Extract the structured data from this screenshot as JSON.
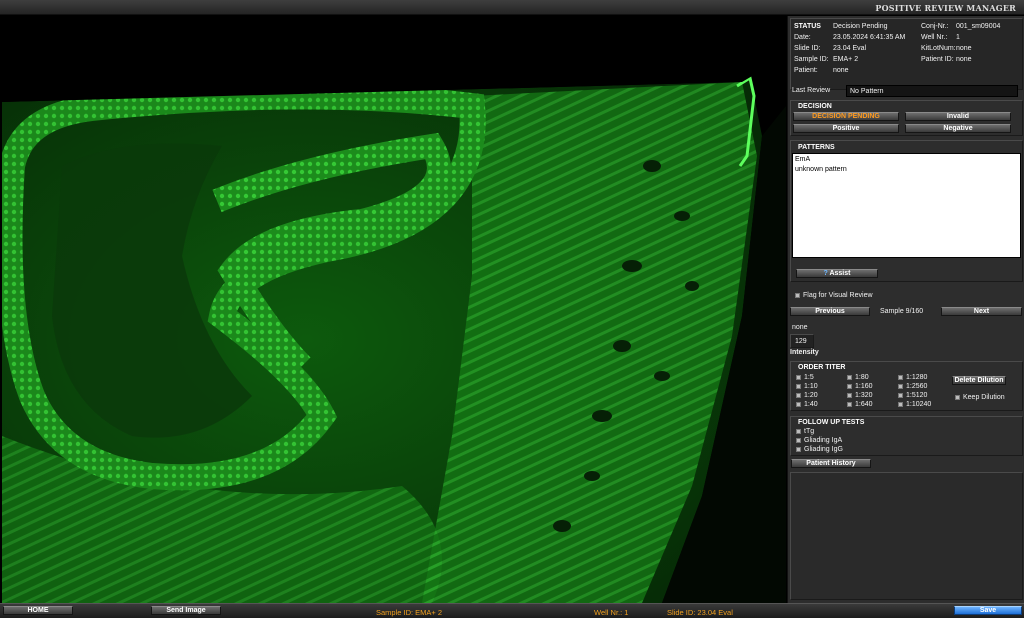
{
  "app_title": "POSITIVE REVIEW MANAGER",
  "status": {
    "header": "STATUS",
    "decision_status": "Decision Pending",
    "date_label": "Date:",
    "date_value": "23.05.2024  6:41:35 AM",
    "slide_id_label": "Slide ID:",
    "slide_id_value": "23.04 Eval",
    "sample_id_label": "Sample ID:",
    "sample_id_value": "EMA+ 2",
    "patient_label": "Patient:",
    "patient_value": "none",
    "conj_nr_label": "Conj-Nr.:",
    "conj_nr_value": "001_sm09004",
    "well_nr_label": "Well Nr.:",
    "well_nr_value": "1",
    "kit_lot_label": "KitLotNum:",
    "kit_lot_value": "none",
    "patient_id_label": "Patient ID:",
    "patient_id_value": "none"
  },
  "last_review": {
    "label": "Last Review",
    "value": "No Pattern"
  },
  "decision": {
    "header": "DECISION",
    "pending": "DECISION PENDING",
    "invalid": "Invalid",
    "positive": "Positive",
    "negative": "Negative"
  },
  "patterns": {
    "header": "PATTERNS",
    "items": [
      "EmA",
      "unknown pattern"
    ],
    "assist": "Assist"
  },
  "flag_label": "Flag for Visual Review",
  "navigation": {
    "previous": "Previous",
    "sample_counter": "Sample 9/160",
    "next": "Next"
  },
  "pattern_result": "none",
  "intensity": {
    "value": "129",
    "label": "Intensity"
  },
  "order_titer": {
    "header": "ORDER TITER",
    "col1": [
      "1:5",
      "1:10",
      "1:20",
      "1:40"
    ],
    "col2": [
      "1:80",
      "1:160",
      "1:320",
      "1:640"
    ],
    "col3": [
      "1:1280",
      "1:2560",
      "1:5120",
      "1:10240"
    ],
    "delete_dilution": "Delete Dilution",
    "keep_dilution": "Keep Dilution"
  },
  "follow_up": {
    "header": "FOLLOW UP TESTS",
    "tests": [
      "tTg",
      "Gliading IgA",
      "Gliading IgG"
    ],
    "patient_history": "Patient History"
  },
  "bottom_bar": {
    "home": "HOME",
    "send_image": "Send Image",
    "sample_id": "Sample ID: EMA+ 2",
    "well_nr": "Well Nr.: 1",
    "slide_id": "Slide ID: 23.04 Eval",
    "save": "Save"
  },
  "colors": {
    "accent_orange": "#f0a020",
    "fluorescence_green": "#2fd62f",
    "save_blue": "#1e6fd6"
  }
}
